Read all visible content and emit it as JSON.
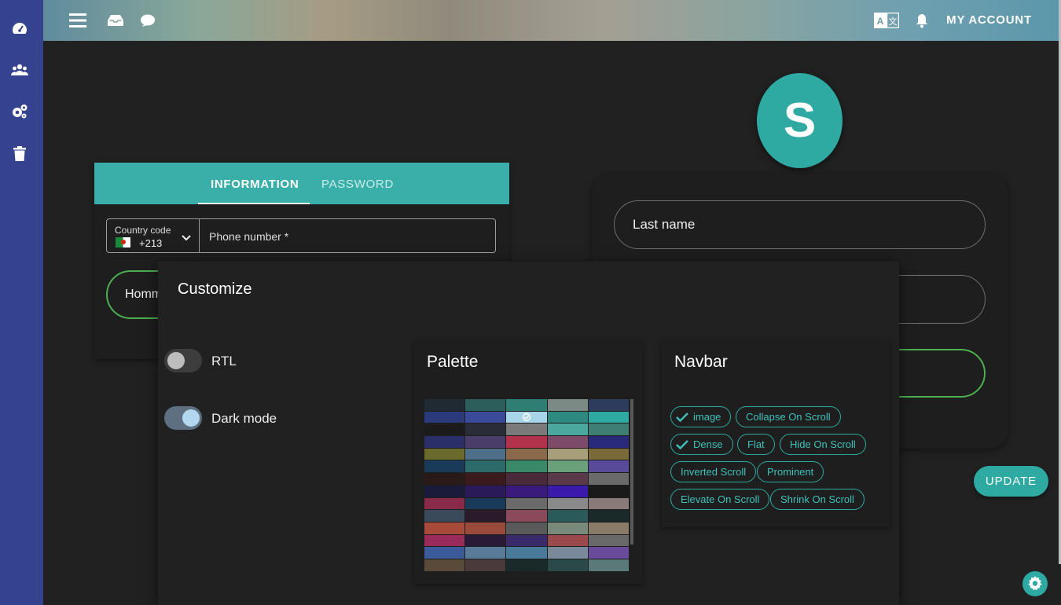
{
  "sidebar": {
    "items": [
      {
        "icon": "dashboard-icon"
      },
      {
        "icon": "users-icon"
      },
      {
        "icon": "settings-cogs-icon"
      },
      {
        "icon": "trash-icon"
      }
    ]
  },
  "topbar": {
    "account_label": "MY ACCOUNT",
    "icons": [
      "menu-icon",
      "inbox-icon",
      "chat-icon",
      "translate-icon",
      "bell-icon"
    ]
  },
  "form": {
    "tabs": [
      {
        "label": "INFORMATION",
        "active": true
      },
      {
        "label": "PASSWORD",
        "active": false
      }
    ],
    "country_code_label": "Country code",
    "country_code_value": "+213",
    "phone_placeholder": "Phone number *",
    "gender_value": "Homm"
  },
  "profile": {
    "avatar_letter": "S",
    "last_name_placeholder": "Last name",
    "update_label": "UPDATE"
  },
  "customize": {
    "title": "Customize",
    "rtl_label": "RTL",
    "rtl_on": false,
    "dark_mode_label": "Dark mode",
    "dark_mode_on": true,
    "palette_title": "Palette",
    "navbar_title": "Navbar",
    "navbar_options": [
      {
        "label": "image",
        "checked": true
      },
      {
        "label": "Collapse On Scroll",
        "checked": false
      },
      {
        "label": "Dense",
        "checked": true
      },
      {
        "label": "Flat",
        "checked": false
      },
      {
        "label": "Hide On Scroll",
        "checked": false
      },
      {
        "label": "Inverted Scroll",
        "checked": false
      },
      {
        "label": "Prominent",
        "checked": false
      },
      {
        "label": "Elevate On Scroll",
        "checked": false
      },
      {
        "label": "Shrink On Scroll",
        "checked": false
      }
    ],
    "palette_rows": [
      [
        "#1f2a33",
        "#2c5f5c",
        "#2f7e74",
        "#7c8a86",
        "#2d3b5c"
      ],
      [
        "#2b3a7a",
        "#3a4b9a",
        "#a8d6e8",
        "#2e8a80",
        "#2eaaa3"
      ],
      [
        "#1b1b1b",
        "#2a2d38",
        "#7a7a7a",
        "#4aa89e",
        "#3f7e73"
      ],
      [
        "#2a2f6a",
        "#4a3d6a",
        "#b2324c",
        "#7d4a6a",
        "#2a2a7a"
      ],
      [
        "#6a6a2a",
        "#4f6e8a",
        "#8a6a4a",
        "#a89e7a",
        "#7a6a3a"
      ],
      [
        "#1a3a5a",
        "#2d6a6a",
        "#3a8a6a",
        "#6aa07a",
        "#5a4a9a"
      ],
      [
        "#2a1a1a",
        "#3a1a1a",
        "#4a2a3a",
        "#5a3a4a",
        "#6a6a6a"
      ],
      [
        "#1a1a3a",
        "#2a1a5a",
        "#3a1a7a",
        "#3a1aaa",
        "#1a1a1a"
      ],
      [
        "#8a2a4a",
        "#1a3a5a",
        "#6a6a6a",
        "#8a8a8a",
        "#8a7a7a"
      ],
      [
        "#3a4a5a",
        "#2a1a2a",
        "#8a4a5a",
        "#2a5a5a",
        "#1a2a2a"
      ],
      [
        "#a84a3a",
        "#9a4a3a",
        "#5a5a5a",
        "#7a8a7a",
        "#8a7a6a"
      ],
      [
        "#9a2a5a",
        "#2a1a3a",
        "#3a2a6a",
        "#9a4a4a",
        "#6a6a6a"
      ],
      [
        "#3a5a9a",
        "#5a7a9a",
        "#4a7a9a",
        "#7a8a9a",
        "#6a4a9a"
      ],
      [
        "#5a4a3a",
        "#4a3a3a",
        "#1a2a2a",
        "#2a4a4a",
        "#5a7a7a"
      ]
    ],
    "palette_selected_row": 1,
    "palette_selected_col": 2
  },
  "colors": {
    "rail": "#35438f",
    "accent": "#2eaaa3",
    "success": "#4caf50",
    "background": "#212121"
  }
}
